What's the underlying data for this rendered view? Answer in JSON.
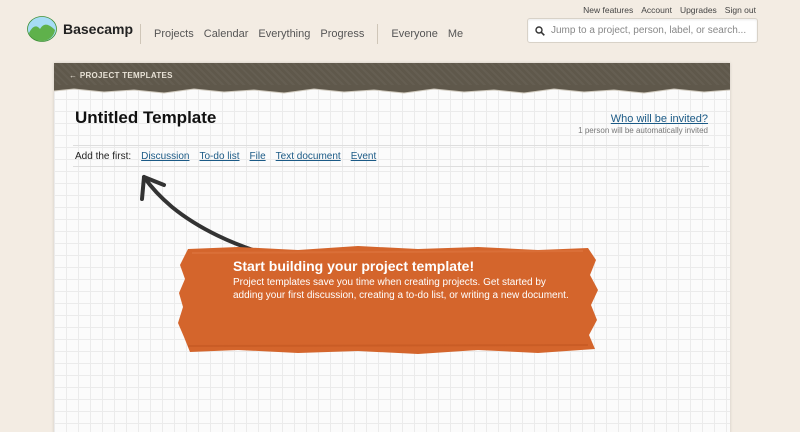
{
  "util_links": [
    "New features",
    "Account",
    "Upgrades",
    "Sign out"
  ],
  "header": {
    "brand": "Basecamp",
    "nav_primary": [
      "Projects",
      "Calendar",
      "Everything",
      "Progress"
    ],
    "nav_secondary": [
      "Everyone",
      "Me"
    ]
  },
  "search": {
    "placeholder": "Jump to a project, person, label, or search..."
  },
  "card": {
    "back_link": "← PROJECT TEMPLATES",
    "title": "Untitled Template",
    "invite_link": "Who will be invited?",
    "invite_note": "1 person will be automatically invited",
    "add_label": "Add the first:",
    "add_links": [
      "Discussion",
      "To-do list",
      "File",
      "Text document",
      "Event"
    ]
  },
  "promo": {
    "title": "Start building your project template!",
    "body": "Project templates save you time when creating projects. Get started by adding your first discussion, creating a to-do list, or writing a new document."
  },
  "colors": {
    "background": "#f3ece3",
    "bar": "#5f584b",
    "link": "#1b5a86",
    "promo": "#d4652c"
  }
}
